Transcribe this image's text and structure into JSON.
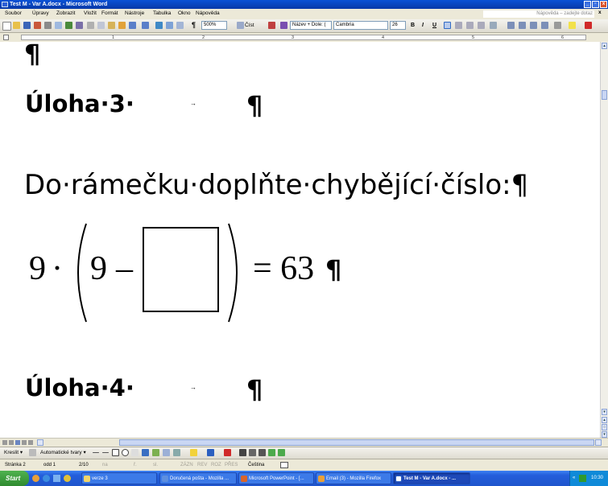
{
  "window": {
    "title": "Test M - Var A.docx - Microsoft Word",
    "btn_min": "_",
    "btn_max": "▫",
    "btn_close": "x"
  },
  "menu": {
    "items": [
      "Soubor",
      "Úpravy",
      "Zobrazit",
      "Vložit",
      "Formát",
      "Nástroje",
      "Tabulka",
      "Okno",
      "Nápověda"
    ],
    "help_placeholder": "Nápověda – zadejte dotaz",
    "close_doc": "x"
  },
  "toolbar": {
    "zoom": "500%",
    "read_label": "Číst",
    "style": "Název + Dole: (",
    "font": "Cambria",
    "size": "26",
    "bold": "B",
    "italic": "I",
    "underline": "U"
  },
  "ruler": {
    "numbers": [
      "1",
      "2",
      "3",
      "4",
      "5",
      "6"
    ]
  },
  "document": {
    "pilcrow": "¶",
    "task3_label": "Úloha·3·",
    "tab_arrow": "→",
    "instruction": "Do·rámečku·doplňte·chybějící·číslo:¶",
    "eq_nine_a": "9",
    "eq_dot": "·",
    "eq_nine_b": "9",
    "eq_minus": "–",
    "eq_right": "= 63",
    "task4_label": "Úloha·4·"
  },
  "drawbar": {
    "draw": "Kreslit ▾",
    "autoshapes": "Automatické tvary ▾"
  },
  "status": {
    "page": "Stránka  2",
    "section": "odd  1",
    "pages": "2/10",
    "at": "na",
    "line": "ř.",
    "col": "sl.",
    "rec": "ZÁZN",
    "trk": "REV",
    "ext": "ROZ",
    "ovr": "PŘES",
    "lang": "Čeština"
  },
  "taskbar": {
    "start": "Start",
    "tasks": [
      "verze 3",
      "Doručená pošta - Mozilla ...",
      "Microsoft PowerPoint - [...",
      "Email (3) - Mozilla Firefox",
      "Test M - Var A.docx - ..."
    ],
    "clock": "10:30",
    "tray_chevron": "«"
  }
}
